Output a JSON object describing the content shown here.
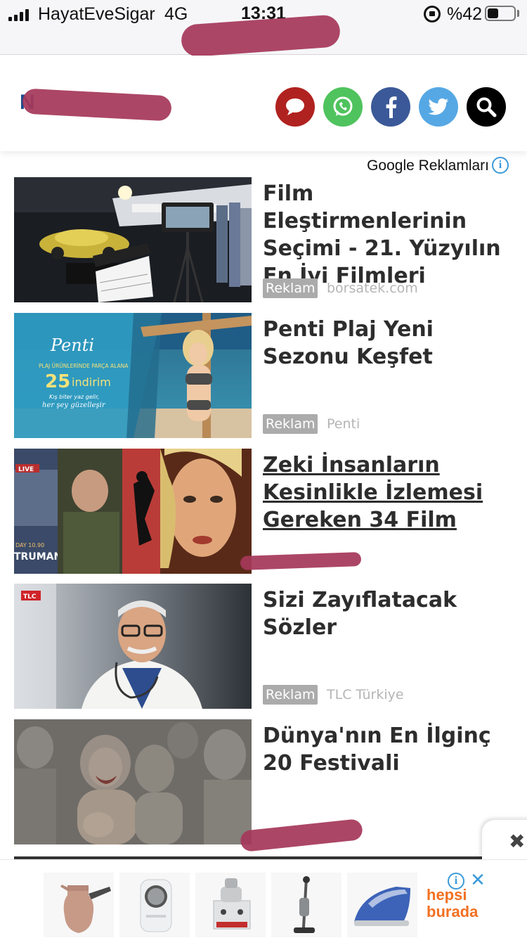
{
  "status_bar": {
    "carrier": "HayatEveSigar",
    "network": "4G",
    "time": "13:31",
    "battery_percent": "%42",
    "battery_level": 0.42
  },
  "header": {
    "logo_text": "N",
    "buttons": [
      {
        "icon": "comment-icon",
        "color": "#b0221f"
      },
      {
        "icon": "whatsapp-icon",
        "color": "#4fc35d"
      },
      {
        "icon": "facebook-icon",
        "color": "#3b5998"
      },
      {
        "icon": "twitter-icon",
        "color": "#56a8e4"
      },
      {
        "icon": "search-icon",
        "color": "#000000"
      }
    ]
  },
  "ads": {
    "label": "Google Reklamları",
    "badge_label": "Reklam",
    "items": [
      {
        "title": "Film Eleştirmenlerinin Seçimi - 21. Yüzyılın En İyi Filmleri",
        "source": "borsatek.com",
        "image": "film-set-photo"
      },
      {
        "title": "Penti Plaj Yeni Sezonu Keşfet",
        "source": "Penti",
        "image": "penti-swimwear-photo",
        "image_text": {
          "brand": "Penti",
          "line1": "PLAJ ÜRÜNLERİNDE PARÇA ALANA",
          "pct": "25",
          "unit": "indirim",
          "line2": "Kış biter yaz gelir,",
          "line3": "her şey güzelleşir"
        }
      },
      {
        "title": "Zeki İnsanların Kesinlikle İzlemesi Gereken 34 Film",
        "source": "",
        "image": "movie-collage-photo",
        "image_text": {
          "tag1": "LIVE",
          "tag2": "DAY 10.90",
          "tag3": "TRUMAN"
        }
      },
      {
        "title": "Sizi Zayıflatacak Sözler",
        "source": "TLC Türkiye",
        "image": "tlc-doctor-photo",
        "image_text": {
          "tag": "TLC"
        }
      },
      {
        "title": "Dünya'nın En İlginç 20 Festivali",
        "source": "",
        "image": "mud-festival-photo"
      }
    ]
  },
  "bottom_banner": {
    "brand_line1": "hepsi",
    "brand_line2": "burada",
    "products": [
      "coffee-pot",
      "air-cooler",
      "tea-machine",
      "vacuum-cleaner",
      "steam-iron"
    ],
    "brand_color": "#f37021"
  },
  "close_label": "✖"
}
